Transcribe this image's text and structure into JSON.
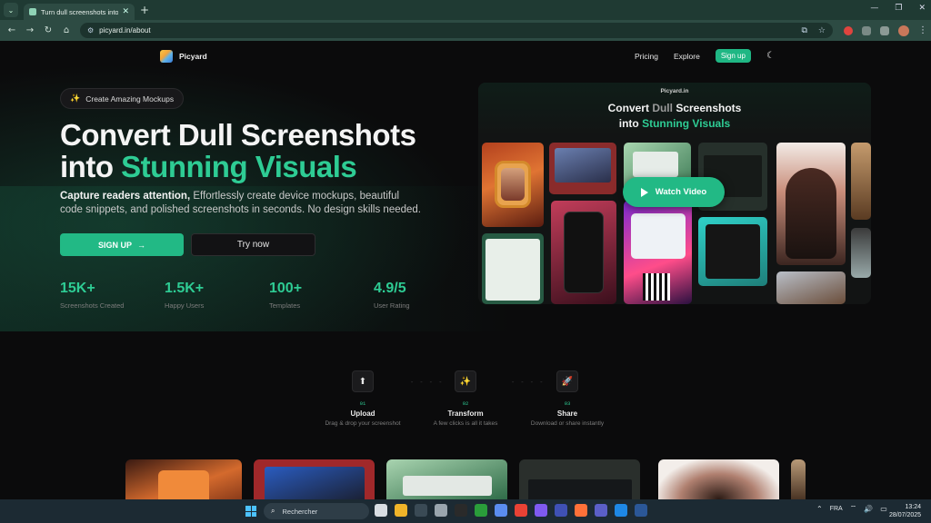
{
  "browser": {
    "tab_title": "Turn dull screenshots into stunn",
    "url": "picyard.in/about",
    "menu_glyph": "⌄",
    "close_glyph": "✕",
    "newtab_glyph": "+",
    "window_controls": [
      "—",
      "❐",
      "✕"
    ],
    "nav_glyphs": [
      "←",
      "→",
      "↻",
      "⌂"
    ],
    "site_info_glyph": "⚙",
    "right_icons": [
      "⧉",
      "☆"
    ],
    "more_glyph": "⋮"
  },
  "nav": {
    "brand": "Picyard",
    "links": [
      "Pricing",
      "Explore"
    ],
    "signup": "Sign up",
    "theme_glyph": "☾"
  },
  "hero": {
    "badge_icon": "✨",
    "badge": "Create Amazing Mockups",
    "title_line1": "Convert Dull Screenshots",
    "title_line2_plain": "into ",
    "title_line2_accent": "Stunning Visuals",
    "sub_bold": "Capture readers attention,",
    "sub_rest": " Effortlessly create device mockups, beautiful code snippets, and polished screenshots in seconds. No design skills needed.",
    "primary_cta": "SIGN UP",
    "primary_arrow": "→",
    "secondary_cta": "Try now",
    "stats": [
      {
        "value": "15K+",
        "label": "Screenshots Created"
      },
      {
        "value": "1.5K+",
        "label": "Happy Users"
      },
      {
        "value": "100+",
        "label": "Templates"
      },
      {
        "value": "4.9/5",
        "label": "User Rating"
      }
    ]
  },
  "preview": {
    "brand": "Picyard.in",
    "title_l1_a": "Convert ",
    "title_l1_b": "Dull",
    "title_l1_c": " Screenshots",
    "title_l2_a": "into ",
    "title_l2_b": "Stunning Visuals",
    "watch_video": "Watch Video"
  },
  "steps": [
    {
      "icon": "⬆",
      "num": "01",
      "name": "Upload",
      "desc": "Drag & drop your screenshot"
    },
    {
      "icon": "✨",
      "num": "02",
      "name": "Transform",
      "desc": "A few clicks is all it takes"
    },
    {
      "icon": "🚀",
      "num": "03",
      "name": "Share",
      "desc": "Download or share instantly"
    }
  ],
  "step_separator": "- - - -",
  "taskbar": {
    "search_icon": "⌕",
    "search_placeholder": "Rechercher",
    "app_colors": [
      "#d8dde2",
      "#f0b429",
      "#3a4a55",
      "#9aa5ad",
      "#2a2a2a",
      "#2a9d3a",
      "#5b8def",
      "#e94235",
      "#7f5af0",
      "#3f51b5",
      "#ff7139",
      "#5b5fc7",
      "#1e88e5",
      "#2b5797"
    ],
    "tray_up": "⌃",
    "lang": "FRA",
    "tray_icons": [
      "⌔",
      "🔊",
      "▭"
    ],
    "time": "13:24",
    "date": "28/07/2025"
  }
}
